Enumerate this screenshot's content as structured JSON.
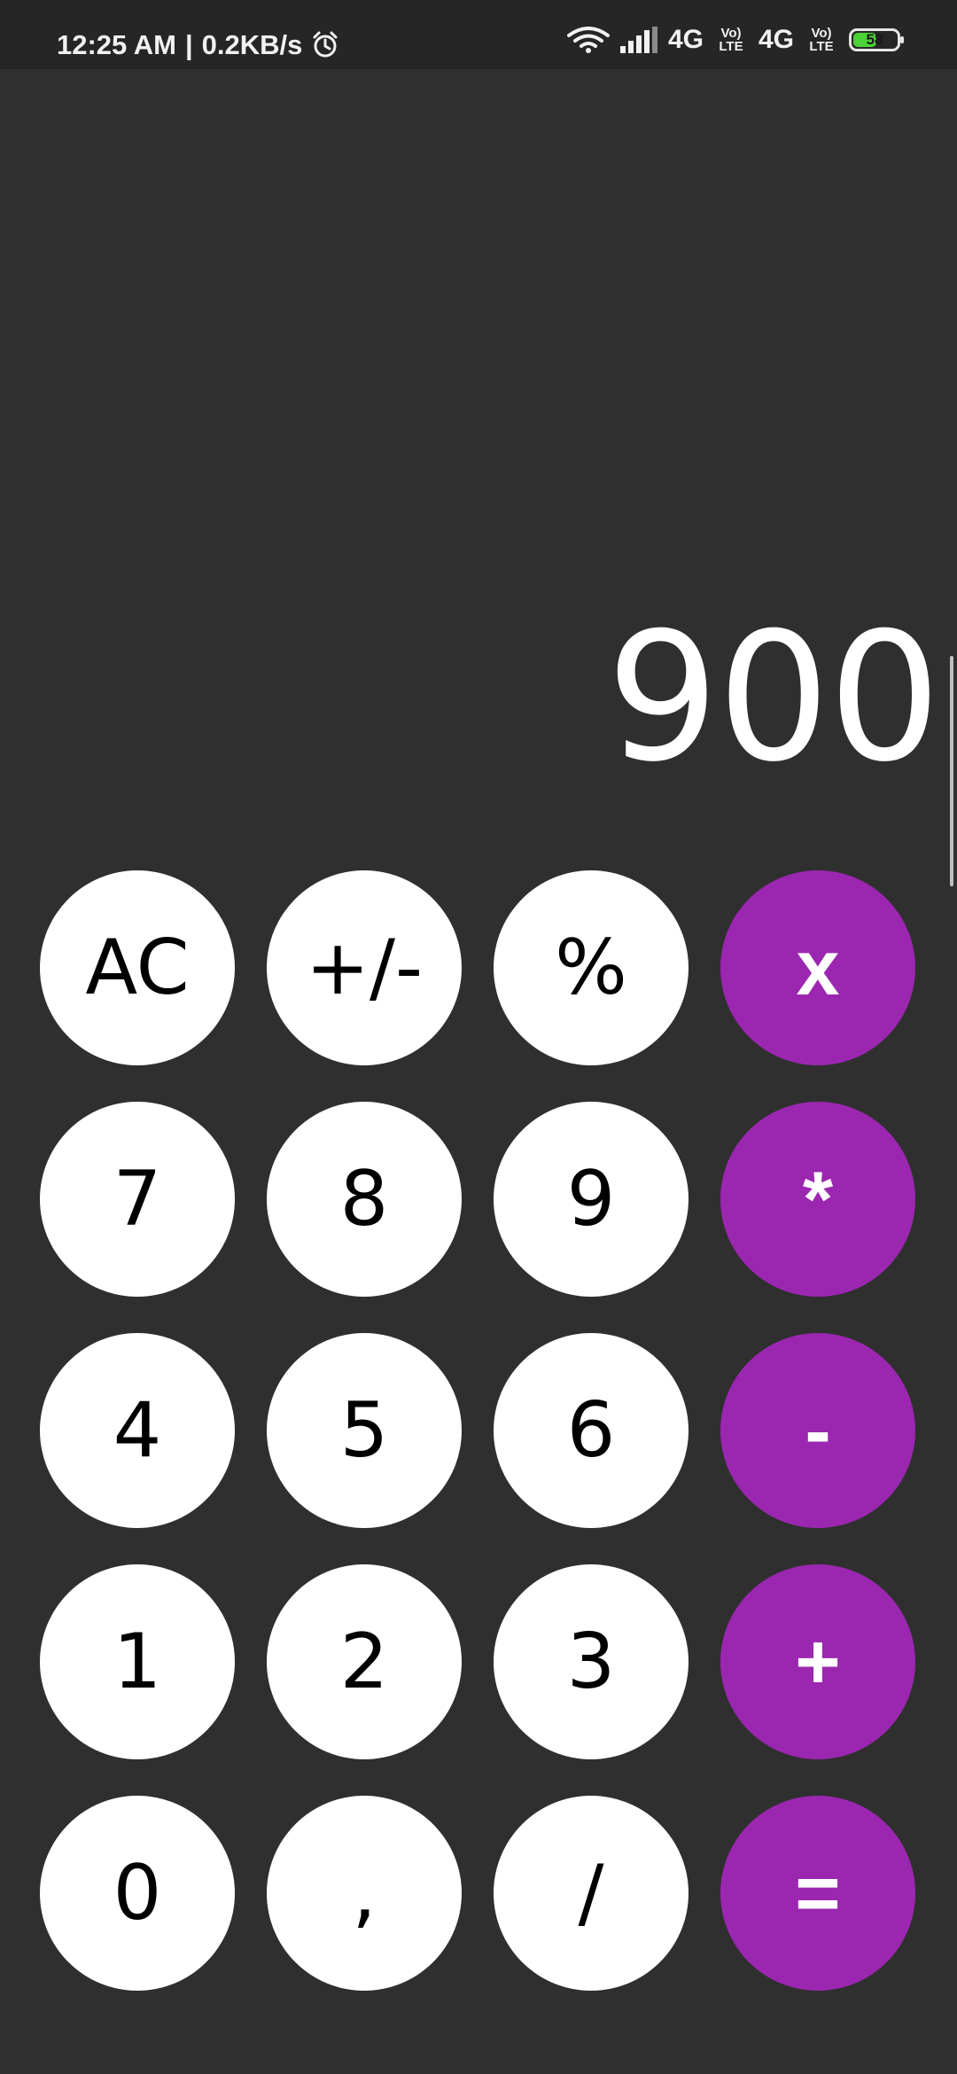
{
  "status_bar": {
    "time": "12:25 AM",
    "separator": "|",
    "speed": "0.2KB/s",
    "alarm_icon": "alarm-icon",
    "wifi_icon": "wifi-icon",
    "signal_icon": "signal-bars-icon",
    "network_1": "4G",
    "volte_1": "Vo) LTE",
    "network_2": "4G",
    "volte_2": "Vo) LTE",
    "battery_level": "58",
    "battery_color": "#4cd137"
  },
  "display": {
    "value": "900"
  },
  "colors": {
    "background": "#2f2f2f",
    "status_bar": "#262626",
    "key_light": "#ffffff",
    "key_operator": "#9b27b0"
  },
  "keys": {
    "ac": "AC",
    "sign": "+/-",
    "percent": "%",
    "x": "x",
    "seven": "7",
    "eight": "8",
    "nine": "9",
    "multiply": "*",
    "four": "4",
    "five": "5",
    "six": "6",
    "minus": "-",
    "one": "1",
    "two": "2",
    "three": "3",
    "plus": "+",
    "zero": "0",
    "comma": ",",
    "divide": "/",
    "equals": "="
  }
}
